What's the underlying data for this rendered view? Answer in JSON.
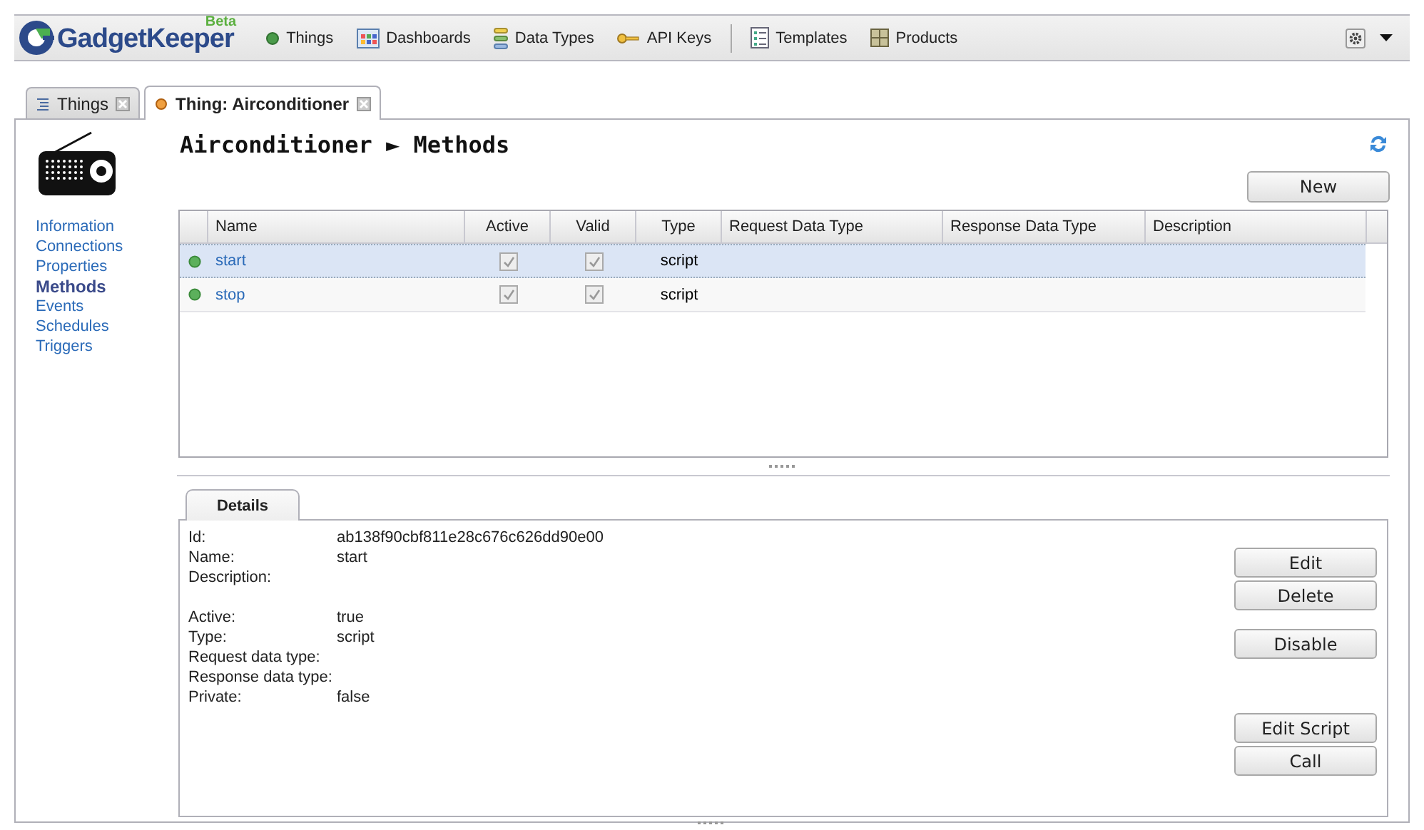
{
  "app": {
    "name": "GadgetKeeper",
    "badge": "Beta"
  },
  "nav": [
    {
      "label": "Things"
    },
    {
      "label": "Dashboards"
    },
    {
      "label": "Data Types"
    },
    {
      "label": "API Keys"
    },
    {
      "label": "Templates"
    },
    {
      "label": "Products"
    }
  ],
  "tabs": [
    {
      "label": "Things",
      "selected": false
    },
    {
      "label": "Thing: Airconditioner",
      "selected": true
    }
  ],
  "sidebar": {
    "items": [
      {
        "label": "Information",
        "selected": false
      },
      {
        "label": "Connections",
        "selected": false
      },
      {
        "label": "Properties",
        "selected": false
      },
      {
        "label": "Methods",
        "selected": true
      },
      {
        "label": "Events",
        "selected": false
      },
      {
        "label": "Schedules",
        "selected": false
      },
      {
        "label": "Triggers",
        "selected": false
      }
    ]
  },
  "breadcrumb": {
    "thing": "Airconditioner",
    "separator": "►",
    "section": "Methods"
  },
  "new_button": "New",
  "table": {
    "columns": [
      "Name",
      "Active",
      "Valid",
      "Type",
      "Request Data Type",
      "Response Data Type",
      "Description"
    ],
    "rows": [
      {
        "name": "start",
        "active": true,
        "valid": true,
        "type": "script",
        "selected": true
      },
      {
        "name": "stop",
        "active": true,
        "valid": true,
        "type": "script",
        "selected": false
      }
    ]
  },
  "details": {
    "tab": "Details",
    "field_groups": [
      [
        {
          "label": "Id:",
          "value": "ab138f90cbf811e28c676c626dd90e00"
        },
        {
          "label": "Name:",
          "value": "start"
        },
        {
          "label": "Description:"
        }
      ],
      [
        {
          "label": "Active:",
          "value": "true"
        },
        {
          "label": "Type:",
          "value": "script"
        },
        {
          "label": "Request data type:"
        },
        {
          "label": "Response data type:"
        },
        {
          "label": "Private:",
          "value": "false"
        }
      ]
    ],
    "button_groups": [
      [
        "Edit",
        "Delete"
      ],
      [
        "Disable"
      ],
      [
        "Edit Script",
        "Call"
      ]
    ]
  }
}
